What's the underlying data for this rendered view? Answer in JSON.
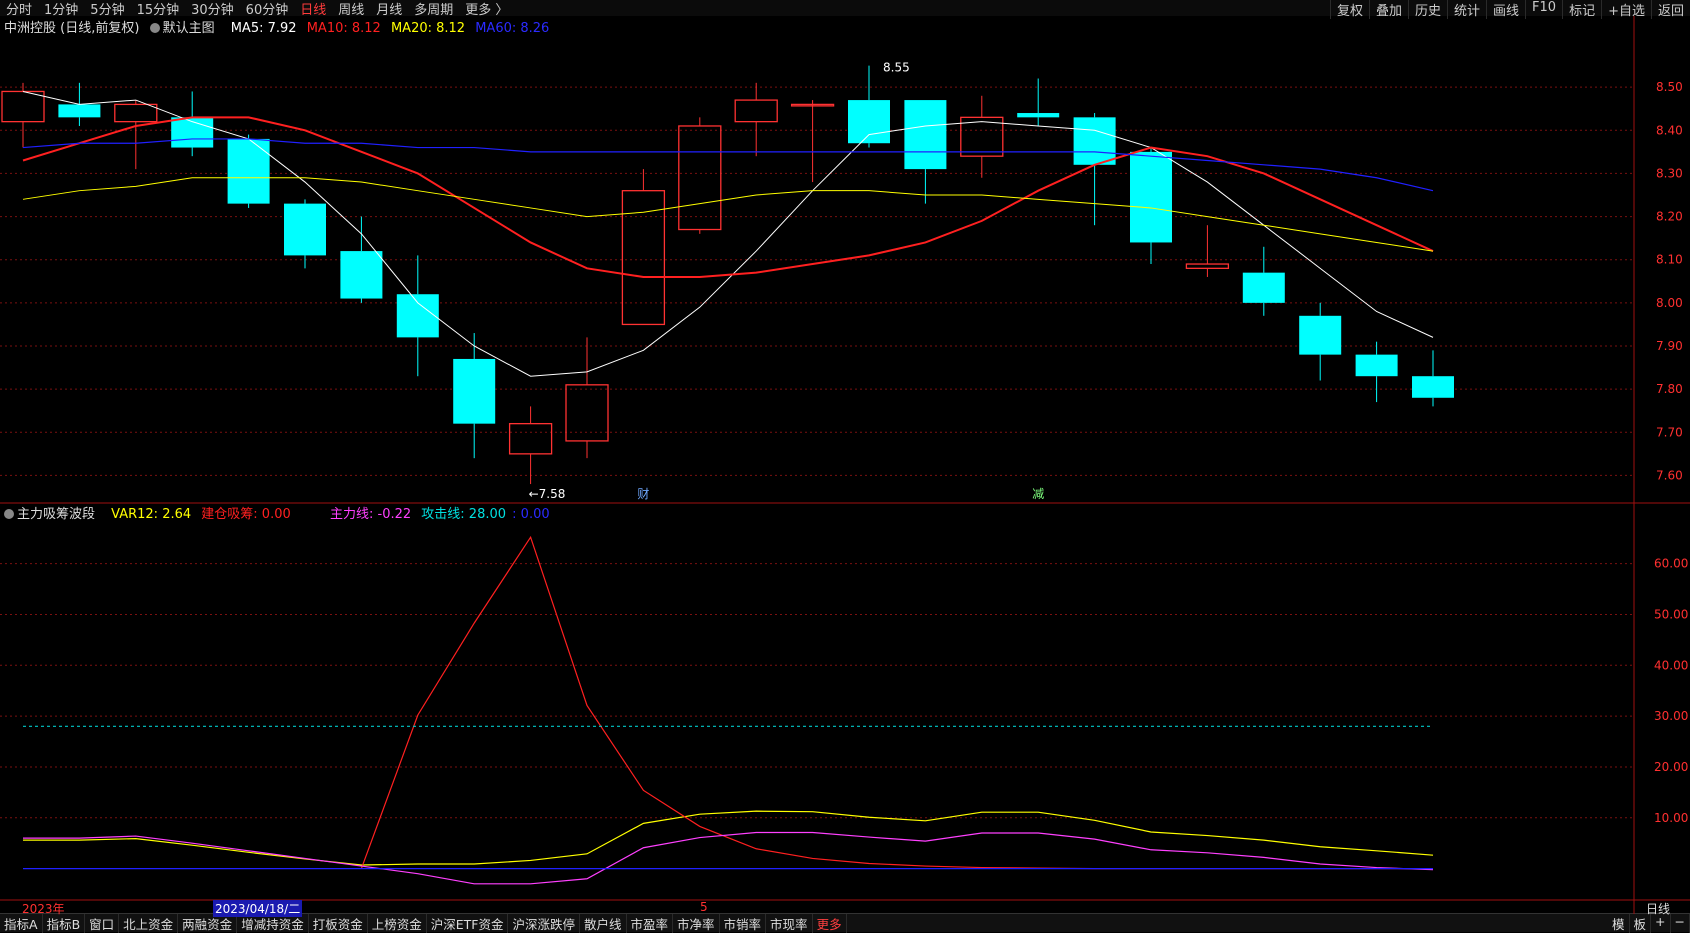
{
  "topbar": {
    "left_items": [
      "分时",
      "1分钟",
      "5分钟",
      "15分钟",
      "30分钟",
      "60分钟",
      "日线",
      "周线",
      "月线",
      "多周期",
      "更多 〉"
    ],
    "active": "日线",
    "right_items": [
      "复权",
      "叠加",
      "历史",
      "统计",
      "画线",
      "F10",
      "标记",
      "+自选",
      "返回"
    ]
  },
  "main_legend": {
    "title": "中洲控股 (日线,前复权)",
    "template": "默认主图",
    "ma5": "MA5: 7.92",
    "ma10": "MA10: 8.12",
    "ma20": "MA20: 8.12",
    "ma60": "MA60: 8.26"
  },
  "sub_legend": {
    "title": "主力吸筹波段",
    "var12": "VAR12: 2.64",
    "jianlang": "建仓吸筹: 0.00",
    "zhuli": "主力线: -0.22",
    "gongji": "攻击线: 28.00",
    "extra": ": 0.00"
  },
  "annotations": {
    "high": "8.55",
    "low": "←7.58",
    "cai": "财",
    "jian": "减"
  },
  "time_axis": {
    "year": "2023年",
    "date": "2023/04/18/二",
    "month": "5",
    "right": "日线"
  },
  "bottombar": {
    "items": [
      "指标A",
      "指标B",
      "窗口",
      "北上资金",
      "两融资金",
      "增减持资金",
      "打板资金",
      "上榜资金",
      "沪深ETF资金",
      "沪深涨跌停",
      "散户线",
      "市盈率",
      "市净率",
      "市销率",
      "市现率",
      "更多"
    ],
    "right_items": [
      "模",
      "板",
      "+",
      "−"
    ]
  },
  "colors": {
    "up": "#ff3232",
    "down": "#00ffff",
    "ma5": "#ffffff",
    "ma10": "#ff2020",
    "ma20": "#ffff00",
    "ma60": "#2020ff",
    "grid": "#7a1010",
    "axis_text": "#ff3030"
  },
  "chart_data": [
    {
      "type": "candlestick",
      "title": "中洲控股 (日线,前复权)",
      "ylim": [
        7.55,
        8.6
      ],
      "yticks": [
        7.6,
        7.7,
        7.8,
        7.9,
        8.0,
        8.1,
        8.2,
        8.3,
        8.4,
        8.5
      ],
      "candles": [
        {
          "o": 8.42,
          "h": 8.51,
          "l": 8.36,
          "c": 8.49
        },
        {
          "o": 8.46,
          "h": 8.51,
          "l": 8.41,
          "c": 8.43
        },
        {
          "o": 8.42,
          "h": 8.47,
          "l": 8.31,
          "c": 8.46
        },
        {
          "o": 8.43,
          "h": 8.49,
          "l": 8.34,
          "c": 8.36
        },
        {
          "o": 8.38,
          "h": 8.39,
          "l": 8.22,
          "c": 8.23
        },
        {
          "o": 8.23,
          "h": 8.24,
          "l": 8.08,
          "c": 8.11
        },
        {
          "o": 8.12,
          "h": 8.2,
          "l": 8.0,
          "c": 8.01
        },
        {
          "o": 8.02,
          "h": 8.11,
          "l": 7.83,
          "c": 7.92
        },
        {
          "o": 7.87,
          "h": 7.93,
          "l": 7.64,
          "c": 7.72
        },
        {
          "o": 7.65,
          "h": 7.76,
          "l": 7.58,
          "c": 7.72
        },
        {
          "o": 7.68,
          "h": 7.92,
          "l": 7.64,
          "c": 7.81
        },
        {
          "o": 7.95,
          "h": 8.31,
          "l": 7.95,
          "c": 8.26
        },
        {
          "o": 8.17,
          "h": 8.43,
          "l": 8.16,
          "c": 8.41
        },
        {
          "o": 8.42,
          "h": 8.51,
          "l": 8.34,
          "c": 8.47
        },
        {
          "o": 8.46,
          "h": 8.47,
          "l": 8.28,
          "c": 8.46
        },
        {
          "o": 8.47,
          "h": 8.55,
          "l": 8.36,
          "c": 8.37
        },
        {
          "o": 8.47,
          "h": 8.47,
          "l": 8.23,
          "c": 8.31
        },
        {
          "o": 8.34,
          "h": 8.48,
          "l": 8.29,
          "c": 8.43
        },
        {
          "o": 8.44,
          "h": 8.52,
          "l": 8.41,
          "c": 8.43
        },
        {
          "o": 8.43,
          "h": 8.44,
          "l": 8.18,
          "c": 8.32
        },
        {
          "o": 8.35,
          "h": 8.36,
          "l": 8.09,
          "c": 8.14
        },
        {
          "o": 8.08,
          "h": 8.18,
          "l": 8.06,
          "c": 8.09
        },
        {
          "o": 8.07,
          "h": 8.13,
          "l": 7.97,
          "c": 8.0
        },
        {
          "o": 7.97,
          "h": 8.0,
          "l": 7.82,
          "c": 7.88
        },
        {
          "o": 7.88,
          "h": 7.91,
          "l": 7.77,
          "c": 7.83
        },
        {
          "o": 7.83,
          "h": 7.89,
          "l": 7.76,
          "c": 7.78
        }
      ],
      "series": [
        {
          "name": "MA5",
          "values": [
            8.49,
            8.46,
            8.47,
            8.42,
            8.38,
            8.28,
            8.16,
            8.0,
            7.9,
            7.83,
            7.84,
            7.89,
            7.99,
            8.12,
            8.26,
            8.39,
            8.41,
            8.42,
            8.41,
            8.4,
            8.36,
            8.28,
            8.18,
            8.08,
            7.98,
            7.92
          ]
        },
        {
          "name": "MA10",
          "values": [
            8.33,
            8.37,
            8.41,
            8.43,
            8.43,
            8.4,
            8.35,
            8.3,
            8.22,
            8.14,
            8.08,
            8.06,
            8.06,
            8.07,
            8.09,
            8.11,
            8.14,
            8.19,
            8.26,
            8.32,
            8.36,
            8.34,
            8.3,
            8.24,
            8.18,
            8.12
          ]
        },
        {
          "name": "MA20",
          "values": [
            8.24,
            8.26,
            8.27,
            8.29,
            8.29,
            8.29,
            8.28,
            8.26,
            8.24,
            8.22,
            8.2,
            8.21,
            8.23,
            8.25,
            8.26,
            8.26,
            8.25,
            8.25,
            8.24,
            8.23,
            8.22,
            8.2,
            8.18,
            8.16,
            8.14,
            8.12
          ]
        },
        {
          "name": "MA60",
          "values": [
            8.36,
            8.37,
            8.37,
            8.38,
            8.38,
            8.37,
            8.37,
            8.36,
            8.36,
            8.35,
            8.35,
            8.35,
            8.35,
            8.35,
            8.35,
            8.35,
            8.35,
            8.35,
            8.35,
            8.35,
            8.34,
            8.33,
            8.32,
            8.31,
            8.29,
            8.26
          ]
        }
      ],
      "marks": {
        "high_index": 15,
        "low_index": 9,
        "cai_index": 11,
        "jian_index": 18
      }
    },
    {
      "type": "line",
      "title": "主力吸筹波段",
      "ylim": [
        -5,
        68
      ],
      "yticks": [
        10,
        20,
        30,
        40,
        50,
        60
      ],
      "series": [
        {
          "name": "VAR12",
          "values": [
            5.6,
            5.6,
            5.9,
            4.6,
            3.2,
            1.9,
            0.7,
            0.9,
            0.9,
            1.6,
            2.9,
            8.9,
            10.7,
            11.3,
            11.2,
            10.1,
            9.4,
            11.1,
            11.1,
            9.5,
            7.2,
            6.5,
            5.6,
            4.3,
            3.5,
            2.64
          ]
        },
        {
          "name": "建仓吸筹",
          "values": [
            null,
            null,
            null,
            null,
            null,
            null,
            0.0,
            30.2,
            48.3,
            65.2,
            32.1,
            15.4,
            8.3,
            3.9,
            2.0,
            1.0,
            0.5,
            0.2,
            0.1,
            0,
            0,
            0,
            0,
            0,
            0,
            0
          ]
        },
        {
          "name": "主力线",
          "values": [
            6.0,
            6.0,
            6.4,
            5.0,
            3.5,
            2.0,
            0.5,
            -1.0,
            -3.0,
            -3.0,
            -2.0,
            4.1,
            6.1,
            7.1,
            7.1,
            6.2,
            5.4,
            7.0,
            7.0,
            5.8,
            3.7,
            3.1,
            2.2,
            0.9,
            0.2,
            -0.22
          ]
        },
        {
          "name": "攻击线",
          "values": [
            28,
            28,
            28,
            28,
            28,
            28,
            28,
            28,
            28,
            28,
            28,
            28,
            28,
            28,
            28,
            28,
            28,
            28,
            28,
            28,
            28,
            28,
            28,
            28,
            28,
            28
          ]
        },
        {
          "name": "zero",
          "values": [
            0,
            0,
            0,
            0,
            0,
            0,
            0,
            0,
            0,
            0,
            0,
            0,
            0,
            0,
            0,
            0,
            0,
            0,
            0,
            0,
            0,
            0,
            0,
            0,
            0,
            0
          ]
        }
      ]
    }
  ]
}
